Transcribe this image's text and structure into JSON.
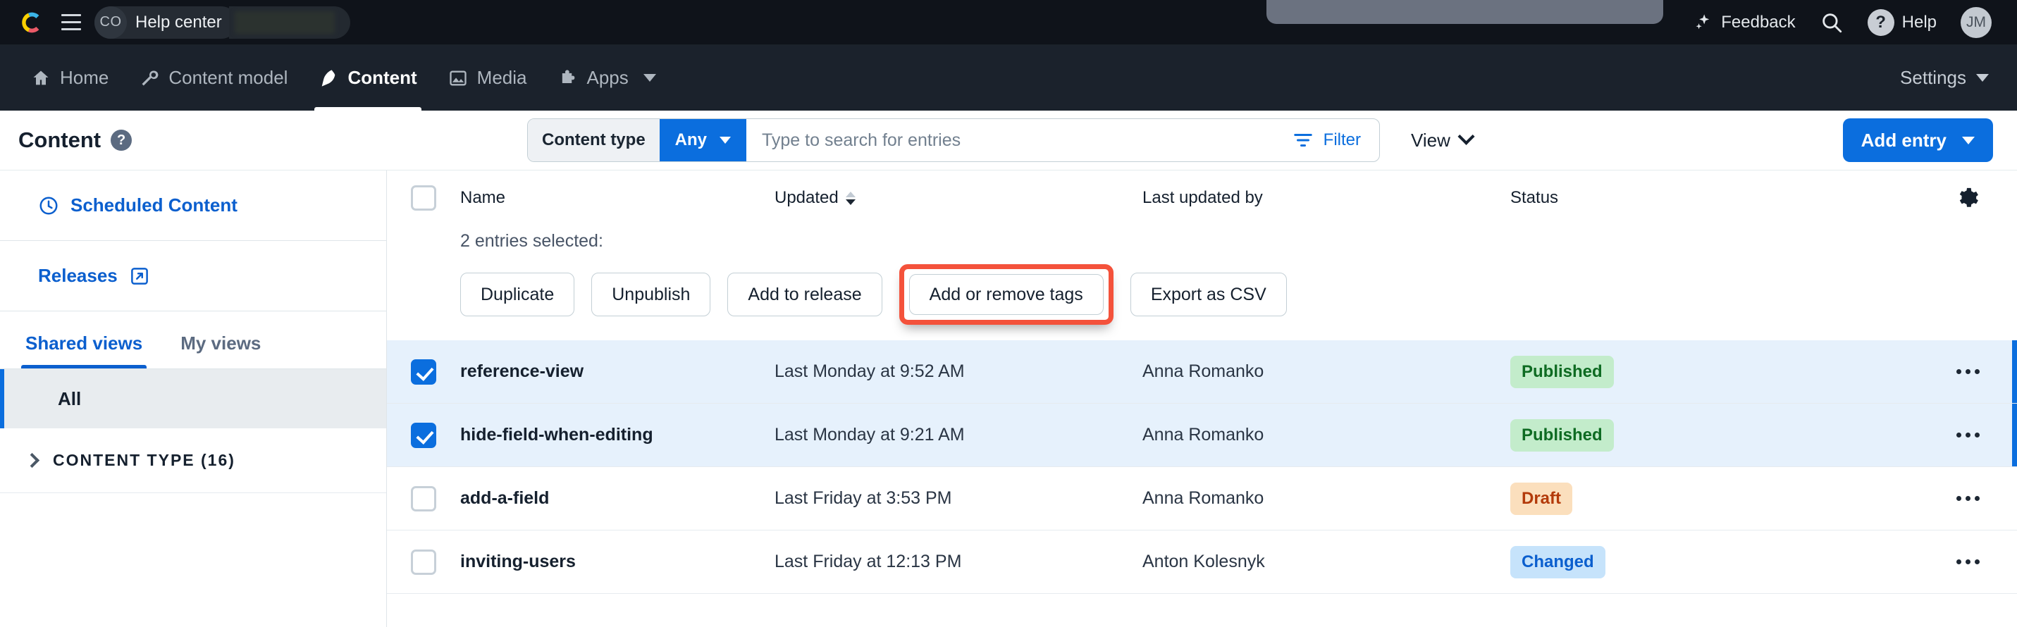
{
  "topbar": {
    "logo_icon": "contentful-logo-icon",
    "menu_icon": "hamburger-menu-icon",
    "space_initials": "CO",
    "space_name": "Help center",
    "feedback_label": "Feedback",
    "feedback_icon": "sparkles-icon",
    "search_icon": "search-icon",
    "help_label": "Help",
    "help_icon": "question-mark-circle-icon",
    "avatar_initials": "JM"
  },
  "nav": {
    "items": [
      {
        "label": "Home",
        "icon": "home-icon",
        "active": false
      },
      {
        "label": "Content model",
        "icon": "wrench-icon",
        "active": false
      },
      {
        "label": "Content",
        "icon": "pen-nib-icon",
        "active": true
      },
      {
        "label": "Media",
        "icon": "image-icon",
        "active": false
      },
      {
        "label": "Apps",
        "icon": "puzzle-piece-icon",
        "active": false,
        "has_caret": true
      }
    ],
    "settings_label": "Settings"
  },
  "toolbar": {
    "page_title": "Content",
    "help_badge": "?",
    "content_type_label": "Content type",
    "content_type_value": "Any",
    "search_placeholder": "Type to search for entries",
    "search_value": "",
    "filter_label": "Filter",
    "filter_icon": "filter-icon",
    "view_label": "View",
    "add_entry_label": "Add entry"
  },
  "sidebar": {
    "scheduled_content": "Scheduled Content",
    "scheduled_icon": "clock-icon",
    "releases": "Releases",
    "releases_icon": "external-link-icon",
    "tabs": [
      {
        "label": "Shared views",
        "active": true
      },
      {
        "label": "My views",
        "active": false
      }
    ],
    "views": [
      {
        "label": "All",
        "selected": true
      }
    ],
    "groups": [
      {
        "label": "CONTENT TYPE (16)",
        "expanded": false,
        "icon": "chevron-right-icon"
      }
    ]
  },
  "table": {
    "columns": {
      "name": "Name",
      "updated": "Updated",
      "last_updated_by": "Last updated by",
      "status": "Status"
    },
    "settings_icon": "gear-icon",
    "sort_icon": "sort-descending-icon",
    "bulk": {
      "count_label": "2 entries selected:",
      "buttons": [
        {
          "label": "Duplicate",
          "highlighted": false
        },
        {
          "label": "Unpublish",
          "highlighted": false
        },
        {
          "label": "Add to release",
          "highlighted": false
        },
        {
          "label": "Add or remove tags",
          "highlighted": true
        },
        {
          "label": "Export as CSV",
          "highlighted": false
        }
      ],
      "highlight_color": "#f4523b"
    },
    "rows": [
      {
        "name": "reference-view",
        "updated": "Last Monday at 9:52 AM",
        "last_updated_by": "Anna Romanko",
        "status": "Published",
        "status_kind": "published",
        "selected": true
      },
      {
        "name": "hide-field-when-editing",
        "updated": "Last Monday at 9:21 AM",
        "last_updated_by": "Anna Romanko",
        "status": "Published",
        "status_kind": "published",
        "selected": true
      },
      {
        "name": "add-a-field",
        "updated": "Last Friday at 3:53 PM",
        "last_updated_by": "Anna Romanko",
        "status": "Draft",
        "status_kind": "draft",
        "selected": false
      },
      {
        "name": "inviting-users",
        "updated": "Last Friday at 12:13 PM",
        "last_updated_by": "Anton Kolesnyk",
        "status": "Changed",
        "status_kind": "changed",
        "selected": false
      }
    ],
    "row_menu_icon": "ellipsis-icon"
  },
  "colors": {
    "accent_blue": "#0b6ede",
    "topbar_bg": "#0f131a",
    "navbar_bg": "#1b222c",
    "selected_row_bg": "#e6f1fc",
    "published_bg": "#c3eccb",
    "published_fg": "#0e6b22",
    "draft_bg": "#fbdfbd",
    "draft_fg": "#b33a0a",
    "changed_bg": "#c6e3fb",
    "changed_fg": "#0b5fce"
  }
}
